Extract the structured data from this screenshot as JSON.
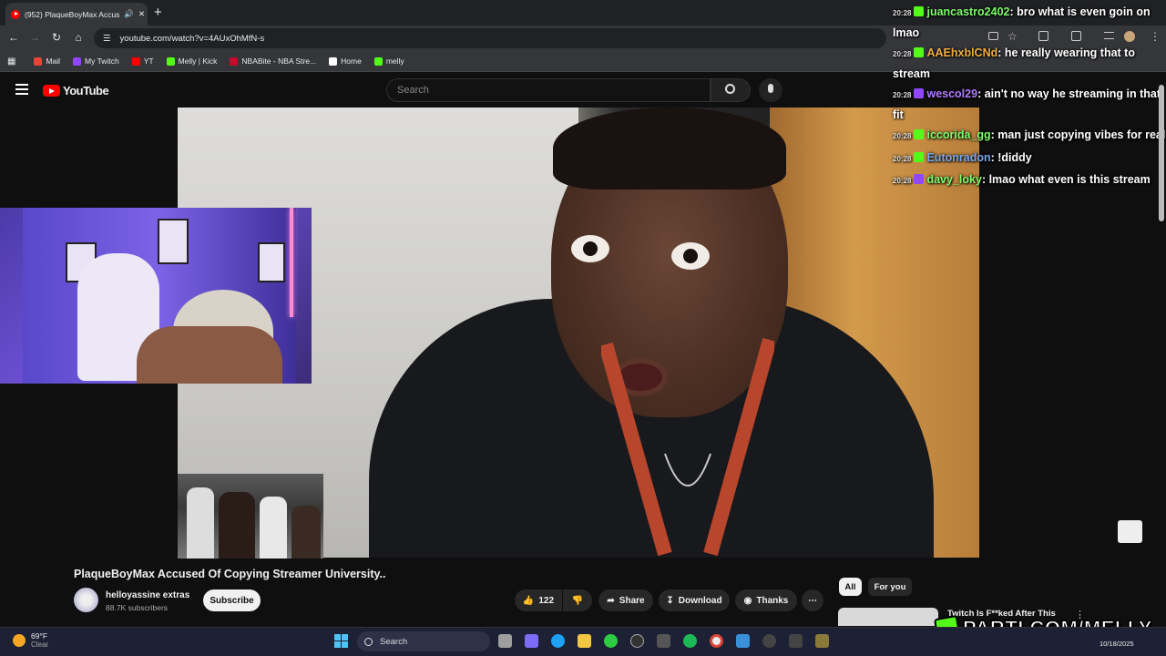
{
  "browser": {
    "tab_title": "(952) PlaqueBoyMax Accus",
    "new_tab_symbol": "+",
    "url": "youtube.com/watch?v=4AUxOhMfN-s",
    "bookmarks": [
      {
        "label": "Mail",
        "color": "#ea4335"
      },
      {
        "label": "My Twitch",
        "color": "#9146ff"
      },
      {
        "label": "YT",
        "color": "#ff0000"
      },
      {
        "label": "Melly | Kick",
        "color": "#53fc18"
      },
      {
        "label": "NBABite - NBA Stre...",
        "color": "#c9082a"
      },
      {
        "label": "Home",
        "color": "#ffffff"
      },
      {
        "label": "melly",
        "color": "#53fc18"
      }
    ]
  },
  "youtube": {
    "logo_text": "YouTube",
    "search_placeholder": "Search",
    "video": {
      "title": "PlaqueBoyMax Accused Of Copying Streamer University..",
      "channel_name": "helloyassine extras",
      "subscribers": "88.7K subscribers",
      "subscribe_label": "Subscribe",
      "likes": "122",
      "share_label": "Share",
      "download_label": "Download",
      "thanks_label": "Thanks",
      "more_label": "⋯"
    },
    "chips": [
      {
        "label": "All",
        "active": true
      },
      {
        "label": "For you",
        "active": false
      }
    ],
    "related_title": "Twitch Is F**ked After This"
  },
  "chat": [
    {
      "time": "20:28",
      "badge": "kick",
      "user": "juancastro2402",
      "user_color": "#7cfc6a",
      "text": ": bro what is even goin on lmao"
    },
    {
      "time": "20:28",
      "badge": "kick",
      "user": "AAEhxblCNd",
      "user_color": "#f0b040",
      "text": ": he really wearing that to stream"
    },
    {
      "time": "20:28",
      "badge": "twitch",
      "user": "wescol29",
      "user_color": "#b07cff",
      "text": ": ain't no way he streaming in that fit"
    },
    {
      "time": "20:28",
      "badge": "kick",
      "user": "iccorida_gg",
      "user_color": "#7cfc6a",
      "text": ": man just copying vibes for real"
    },
    {
      "time": "20:28",
      "badge": "kick",
      "user": "Eutonradon",
      "user_color": "#7aa8e8",
      "text": ": !diddy"
    },
    {
      "time": "20:28",
      "badge": "twitch",
      "user": "davy_loky",
      "user_color": "#7cfc6a",
      "text": ": lmao what even is this stream"
    }
  ],
  "overlay": {
    "parti_text": "PARTI.COM/MELLY"
  },
  "taskbar": {
    "temperature": "69°F",
    "condition": "Clear",
    "search_placeholder": "Search",
    "date": "10/18/2025"
  },
  "icons": {
    "back": "back-arrow-icon",
    "forward": "forward-arrow-icon",
    "reload": "reload-icon",
    "home": "home-icon",
    "search": "search-icon",
    "mic": "microphone-icon",
    "like": "thumbs-up-icon",
    "dislike": "thumbs-down-icon",
    "share": "share-icon",
    "download": "download-icon",
    "thanks": "thanks-icon"
  },
  "colors": {
    "youtube_red": "#ff0000",
    "kick_green": "#53fc18",
    "twitch_purple": "#9146ff",
    "page_bg": "#0f0f0f"
  }
}
